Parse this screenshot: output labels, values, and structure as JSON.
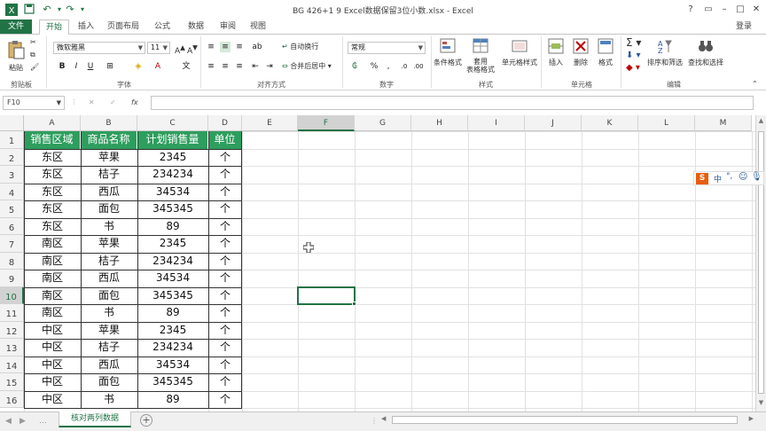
{
  "window": {
    "title": "BG 426+1 9 Excel数据保留3位小数.xlsx - Excel",
    "login": "登录"
  },
  "tabs": [
    "文件",
    "开始",
    "插入",
    "页面布局",
    "公式",
    "数据",
    "审阅",
    "视图"
  ],
  "ribbon": {
    "clipboard": {
      "paste": "粘贴",
      "label": "剪贴板"
    },
    "font": {
      "name": "微软雅黑",
      "size": "11",
      "label": "字体"
    },
    "alignment": {
      "wrap": "自动换行",
      "merge": "合并后居中",
      "label": "对齐方式"
    },
    "number": {
      "format": "常规",
      "label": "数字"
    },
    "styles": {
      "conditional": "条件格式",
      "table_line1": "套用",
      "table_line2": "表格格式",
      "cell_styles": "单元格样式",
      "label": "样式"
    },
    "cells": {
      "insert": "插入",
      "delete": "删除",
      "format": "格式",
      "label": "单元格"
    },
    "editing": {
      "sort": "排序和筛选",
      "find": "查找和选择",
      "label": "编辑"
    }
  },
  "formula_bar": {
    "name_box": "F10",
    "fx": "fx",
    "value": ""
  },
  "grid": {
    "columns": [
      "A",
      "B",
      "C",
      "D",
      "E",
      "F",
      "G",
      "H",
      "I",
      "J",
      "K",
      "L",
      "M"
    ],
    "rows": [
      "1",
      "2",
      "3",
      "4",
      "5",
      "6",
      "7",
      "8",
      "9",
      "10",
      "11",
      "12",
      "13",
      "14",
      "15",
      "16"
    ],
    "header": [
      "销售区域",
      "商品名称",
      "计划销售量",
      "单位"
    ],
    "data": [
      [
        "东区",
        "苹果",
        "2345",
        "个"
      ],
      [
        "东区",
        "桔子",
        "234234",
        "个"
      ],
      [
        "东区",
        "西瓜",
        "34534",
        "个"
      ],
      [
        "东区",
        "面包",
        "345345",
        "个"
      ],
      [
        "东区",
        "书",
        "89",
        "个"
      ],
      [
        "南区",
        "苹果",
        "2345",
        "个"
      ],
      [
        "南区",
        "桔子",
        "234234",
        "个"
      ],
      [
        "南区",
        "西瓜",
        "34534",
        "个"
      ],
      [
        "南区",
        "面包",
        "345345",
        "个"
      ],
      [
        "南区",
        "书",
        "89",
        "个"
      ],
      [
        "中区",
        "苹果",
        "2345",
        "个"
      ],
      [
        "中区",
        "桔子",
        "234234",
        "个"
      ],
      [
        "中区",
        "西瓜",
        "34534",
        "个"
      ],
      [
        "中区",
        "面包",
        "345345",
        "个"
      ],
      [
        "中区",
        "书",
        "89",
        "个"
      ]
    ]
  },
  "sheet_tabs": {
    "active": "核对两列数据"
  },
  "ime": {
    "label": "中"
  },
  "colors": {
    "accent": "#217346",
    "header_fill": "#2e9e5e"
  }
}
